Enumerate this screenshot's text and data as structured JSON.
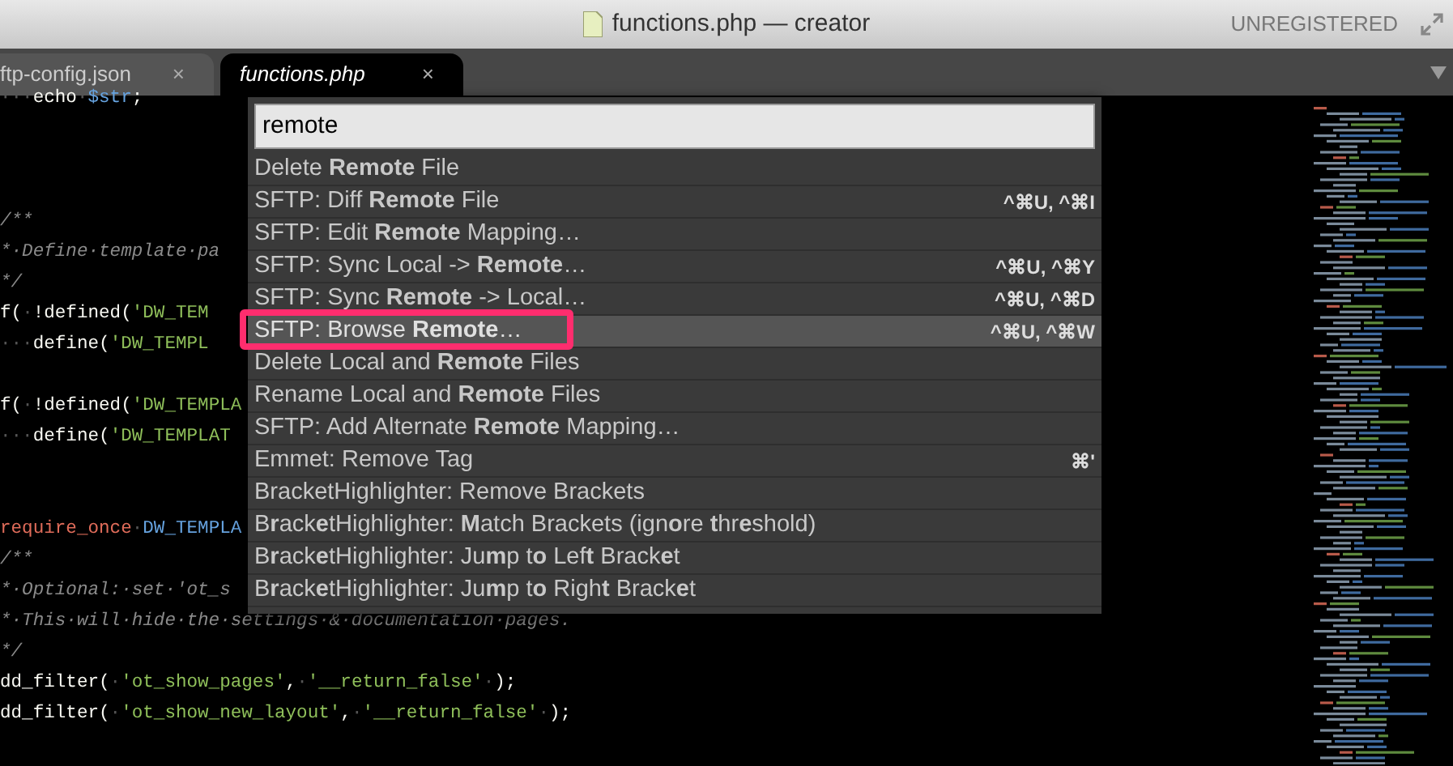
{
  "window": {
    "title": "functions.php — creator",
    "registration": "UNREGISTERED"
  },
  "tabs": [
    {
      "label": "ftp-config.json",
      "close": "×",
      "selected": false
    },
    {
      "label": "functions.php",
      "close": "×",
      "selected": true
    }
  ],
  "code_lines": [
    {
      "kind": "code",
      "tokens": [
        {
          "kind": "ws",
          "text": "···"
        },
        {
          "kind": "plain",
          "text": "echo"
        },
        {
          "kind": "ws",
          "text": "·"
        },
        {
          "kind": "var",
          "text": "$str"
        },
        {
          "kind": "plain",
          "text": ";"
        }
      ]
    },
    {
      "kind": "blank"
    },
    {
      "kind": "blank"
    },
    {
      "kind": "blank"
    },
    {
      "kind": "code",
      "tokens": [
        {
          "kind": "comment",
          "text": "/**"
        }
      ]
    },
    {
      "kind": "code",
      "tokens": [
        {
          "kind": "comment",
          "text": "*·Define·template·pa"
        }
      ]
    },
    {
      "kind": "code",
      "tokens": [
        {
          "kind": "comment",
          "text": "*/"
        }
      ]
    },
    {
      "kind": "code",
      "tokens": [
        {
          "kind": "plain",
          "text": "f("
        },
        {
          "kind": "ws",
          "text": "·"
        },
        {
          "kind": "plain",
          "text": "!defined("
        },
        {
          "kind": "string",
          "text": "'DW_TEM"
        }
      ]
    },
    {
      "kind": "code",
      "tokens": [
        {
          "kind": "ws",
          "text": "···"
        },
        {
          "kind": "plain",
          "text": "define("
        },
        {
          "kind": "string",
          "text": "'DW_TEMPL"
        }
      ]
    },
    {
      "kind": "blank"
    },
    {
      "kind": "code",
      "tokens": [
        {
          "kind": "plain",
          "text": "f("
        },
        {
          "kind": "ws",
          "text": "·"
        },
        {
          "kind": "plain",
          "text": "!defined("
        },
        {
          "kind": "string",
          "text": "'DW_TEMPLA"
        }
      ]
    },
    {
      "kind": "code",
      "tokens": [
        {
          "kind": "ws",
          "text": "···"
        },
        {
          "kind": "plain",
          "text": "define("
        },
        {
          "kind": "string",
          "text": "'DW_TEMPLAT"
        }
      ]
    },
    {
      "kind": "blank"
    },
    {
      "kind": "blank"
    },
    {
      "kind": "code",
      "tokens": [
        {
          "kind": "keyword",
          "text": "require_once"
        },
        {
          "kind": "ws",
          "text": "·"
        },
        {
          "kind": "var",
          "text": "DW_TEMPLA"
        }
      ]
    },
    {
      "kind": "code",
      "tokens": [
        {
          "kind": "comment",
          "text": "/**"
        }
      ]
    },
    {
      "kind": "code",
      "tokens": [
        {
          "kind": "comment",
          "text": "*·Optional:·set·'ot_s"
        }
      ]
    },
    {
      "kind": "code",
      "tokens": [
        {
          "kind": "comment",
          "text": "*·This·will·hide·the·settings·&·documentation·pages."
        }
      ]
    },
    {
      "kind": "code",
      "tokens": [
        {
          "kind": "comment",
          "text": "*/"
        }
      ]
    },
    {
      "kind": "code",
      "tokens": [
        {
          "kind": "plain",
          "text": "dd_filter("
        },
        {
          "kind": "ws",
          "text": "·"
        },
        {
          "kind": "string",
          "text": "'ot_show_pages'"
        },
        {
          "kind": "plain",
          "text": ","
        },
        {
          "kind": "ws",
          "text": "·"
        },
        {
          "kind": "string",
          "text": "'__return_false'"
        },
        {
          "kind": "ws",
          "text": "·"
        },
        {
          "kind": "plain",
          "text": ");"
        }
      ]
    },
    {
      "kind": "code",
      "tokens": [
        {
          "kind": "plain",
          "text": "dd_filter("
        },
        {
          "kind": "ws",
          "text": "·"
        },
        {
          "kind": "string",
          "text": "'ot_show_new_layout'"
        },
        {
          "kind": "plain",
          "text": ","
        },
        {
          "kind": "ws",
          "text": "·"
        },
        {
          "kind": "string",
          "text": "'__return_false'"
        },
        {
          "kind": "ws",
          "text": "·"
        },
        {
          "kind": "plain",
          "text": ");"
        }
      ]
    }
  ],
  "palette": {
    "query": "remote",
    "items": [
      {
        "label": "Delete **Remote** File",
        "selected": false,
        "framed": false
      },
      {
        "label": "SFTP: Diff **Remote** File",
        "shortcut": "^⌘U, ^⌘I",
        "selected": false,
        "framed": false
      },
      {
        "label": "SFTP: Edit **Remote** Mapping…",
        "selected": false,
        "framed": false
      },
      {
        "label": "SFTP: Sync Local -> **Remote**…",
        "shortcut": "^⌘U, ^⌘Y",
        "selected": false,
        "framed": false
      },
      {
        "label": "SFTP: Sync **Remote** -> Local…",
        "shortcut": "^⌘U, ^⌘D",
        "selected": false,
        "framed": false
      },
      {
        "label": "SFTP: Browse **Remote**…",
        "shortcut": "^⌘U, ^⌘W",
        "selected": true,
        "framed": true
      },
      {
        "label": "Delete Local and **Remote** Files",
        "selected": false,
        "framed": false
      },
      {
        "label": "Rename Local and **Remote** Files",
        "selected": false,
        "framed": false
      },
      {
        "label": "SFTP: Add Alternate **Remote** Mapping…",
        "selected": false,
        "framed": false
      },
      {
        "label": "Emmet: Remove Tag",
        "shortcut": "⌘'",
        "selected": false,
        "framed": false
      },
      {
        "label": "BracketHighlighter: Remove Brackets",
        "selected": false,
        "framed": false
      },
      {
        "label": "B**r**ack**e**tHighlighter: **M**atch Brackets (ign**o**re **t**hr**e**shold)",
        "selected": false,
        "framed": false
      },
      {
        "label": "B**r**ack**e**tHighlighter: Ju**m**p t**o** Lef**t** Brack**e**t",
        "selected": false,
        "framed": false
      },
      {
        "label": "B**r**ack**e**tHighlighter: Ju**m**p t**o** Righ**t** Brack**e**t",
        "selected": false,
        "framed": false
      }
    ]
  }
}
